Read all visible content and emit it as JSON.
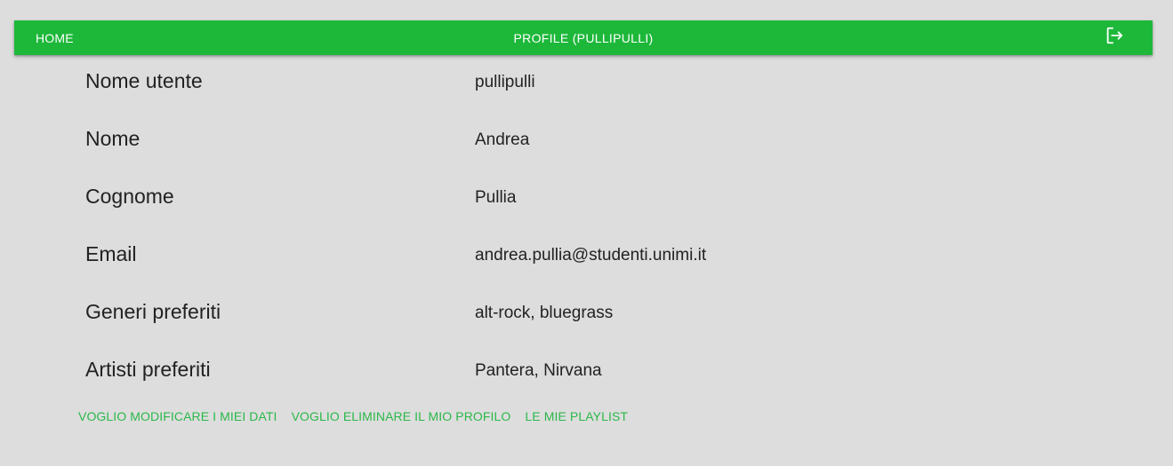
{
  "appbar": {
    "home_label": "HOME",
    "title": "PROFILE (PULLIPULLI)",
    "logout_icon": "logout-icon"
  },
  "profile": {
    "rows": [
      {
        "label": "Nome utente",
        "value": "pullipulli"
      },
      {
        "label": "Nome",
        "value": "Andrea"
      },
      {
        "label": "Cognome",
        "value": "Pullia"
      },
      {
        "label": "Email",
        "value": "andrea.pullia@studenti.unimi.it"
      },
      {
        "label": "Generi preferiti",
        "value": "alt-rock, bluegrass"
      },
      {
        "label": "Artisti preferiti",
        "value": "Pantera, Nirvana"
      }
    ]
  },
  "actions": {
    "edit_label": "VOGLIO MODIFICARE I MIEI DATI",
    "delete_label": "VOGLIO ELIMINARE IL MIO PROFILO",
    "playlists_label": "LE MIE PLAYLIST"
  },
  "colors": {
    "appbar": "#1db83a",
    "background": "#dddddd",
    "accent_text": "#2bb84a"
  }
}
